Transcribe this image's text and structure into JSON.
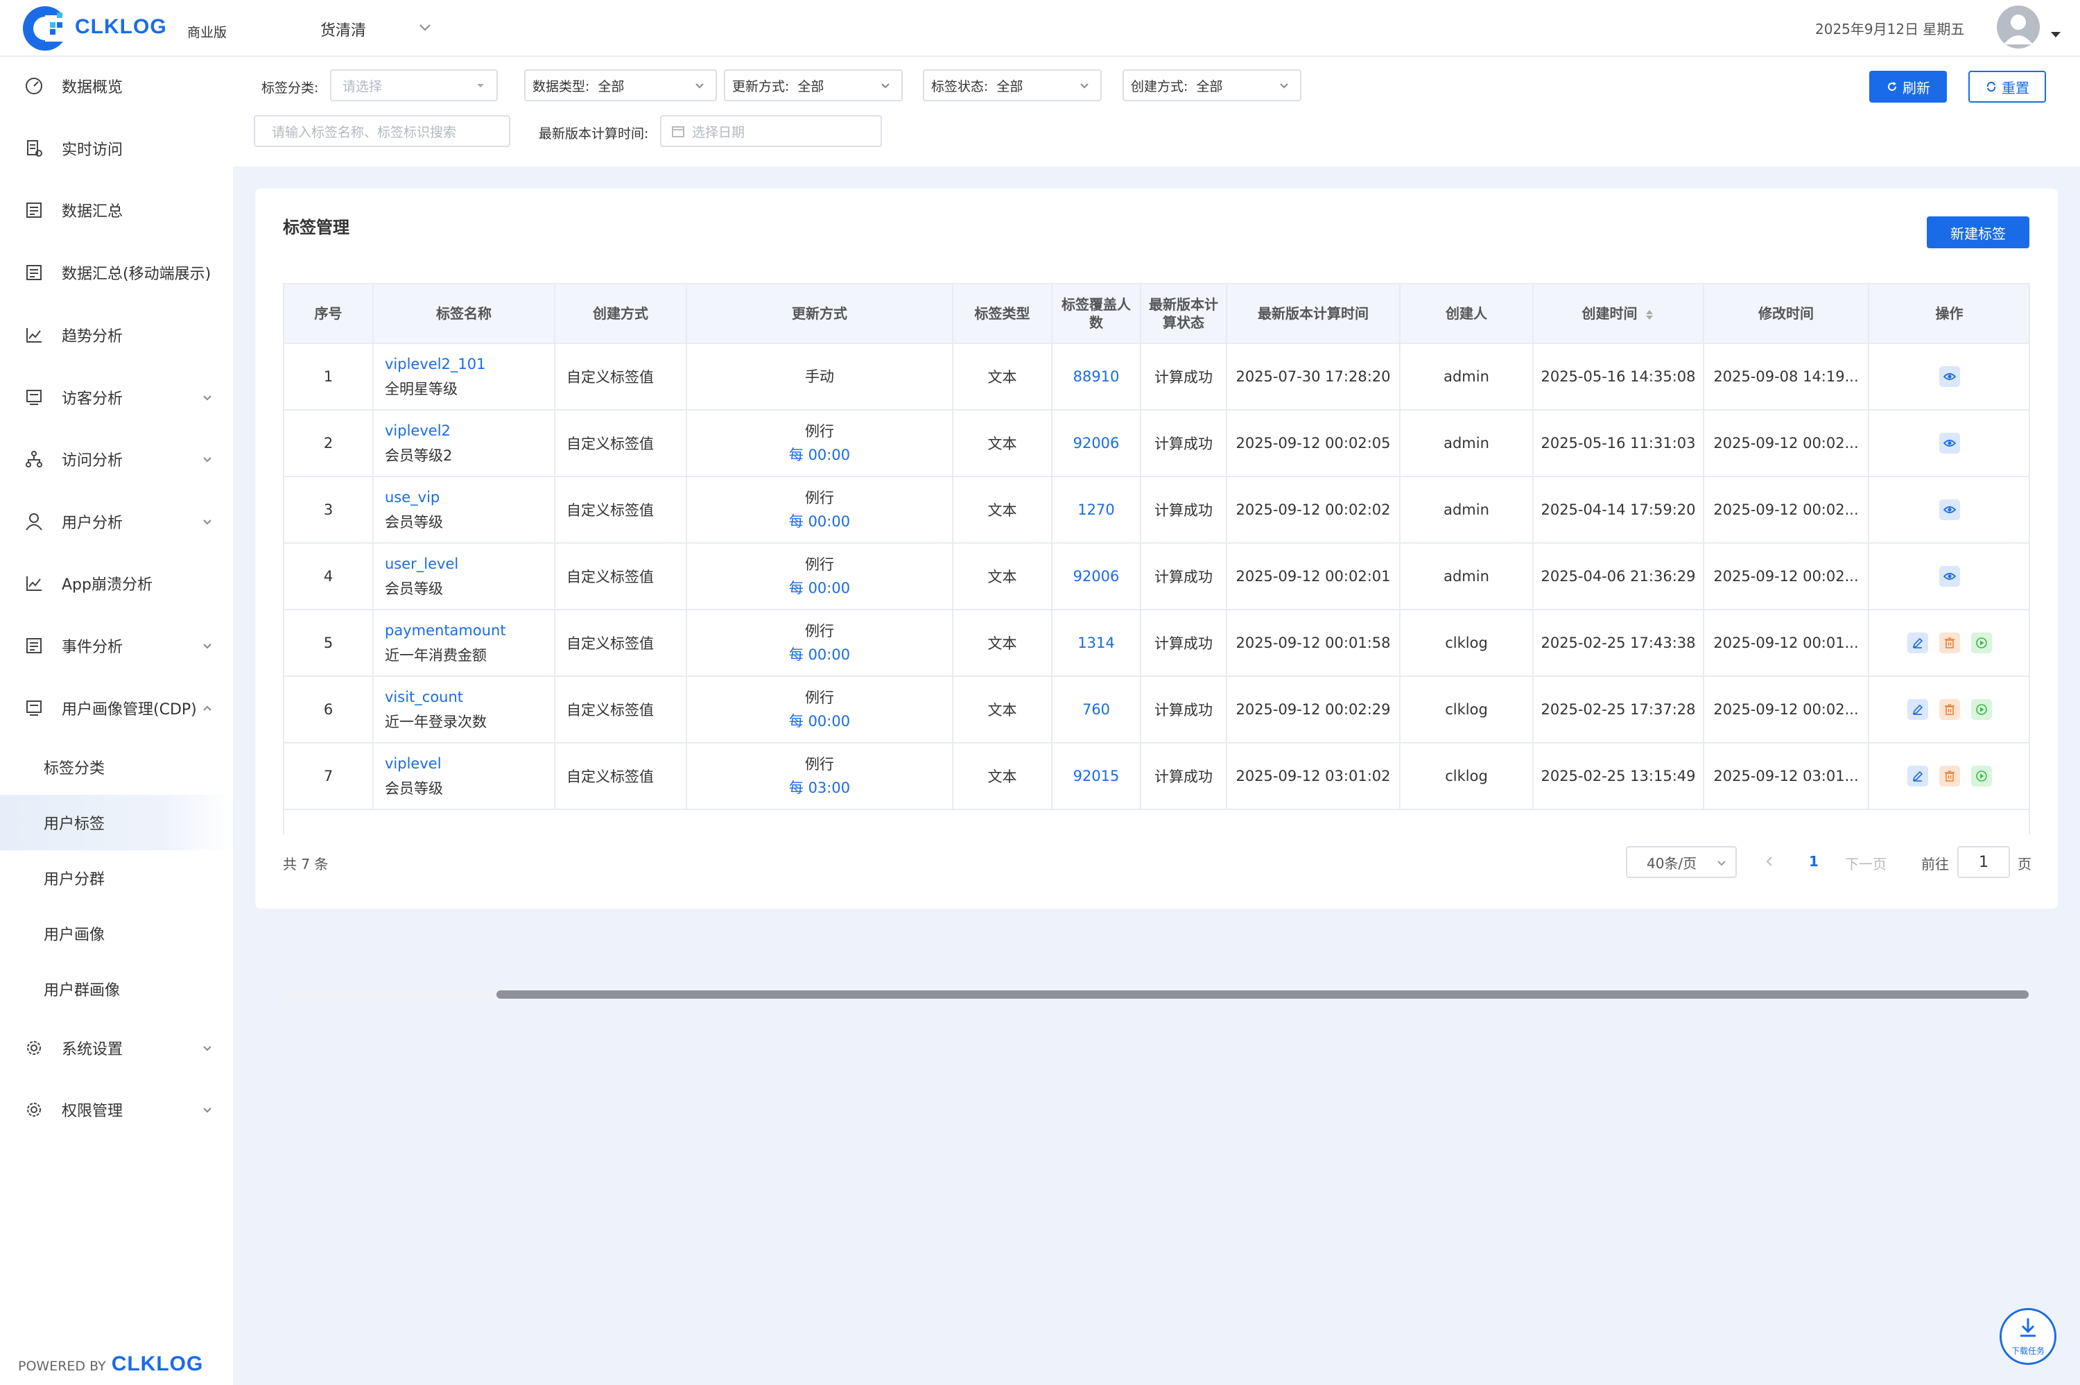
{
  "header": {
    "brand": "CLKLOG",
    "edition": "商业版",
    "org": "货清清",
    "date": "2025年9月12日 星期五"
  },
  "sidebar": {
    "items": [
      {
        "label": "数据概览",
        "icon": "dashboard-icon"
      },
      {
        "label": "实时访问",
        "icon": "realtime-icon"
      },
      {
        "label": "数据汇总",
        "icon": "summary-icon"
      },
      {
        "label": "数据汇总(移动端展示)",
        "icon": "summary-mobile-icon"
      },
      {
        "label": "趋势分析",
        "icon": "trend-icon"
      },
      {
        "label": "访客分析",
        "icon": "visitor-icon"
      },
      {
        "label": "访问分析",
        "icon": "visit-icon"
      },
      {
        "label": "用户分析",
        "icon": "user-icon"
      },
      {
        "label": "App崩溃分析",
        "icon": "crash-icon"
      },
      {
        "label": "事件分析",
        "icon": "event-icon"
      },
      {
        "label": "用户画像管理(CDP)",
        "icon": "cdp-icon"
      },
      {
        "label": "系统设置",
        "icon": "settings-icon"
      },
      {
        "label": "权限管理",
        "icon": "permission-icon"
      }
    ],
    "sub_items": [
      "标签分类",
      "用户标签",
      "用户分群",
      "用户画像",
      "用户群画像"
    ],
    "active_sub": "用户标签",
    "powered_by": "POWERED BY",
    "powered_brand": "CLKLOG"
  },
  "filters": {
    "category_label": "标签分类:",
    "category_placeholder": "请选择",
    "data_type_label": "数据类型:",
    "data_type_value": "全部",
    "update_label": "更新方式:",
    "update_value": "全部",
    "status_label": "标签状态:",
    "status_value": "全部",
    "create_label": "创建方式:",
    "create_value": "全部",
    "search_placeholder": "请输入标签名称、标签标识搜索",
    "calc_time_label": "最新版本计算时间:",
    "date_placeholder": "选择日期",
    "refresh": "刷新",
    "reset": "重置"
  },
  "card": {
    "title": "标签管理",
    "new_button": "新建标签"
  },
  "table": {
    "headers": [
      "序号",
      "标签名称",
      "创建方式",
      "更新方式",
      "标签类型",
      "标签覆盖人数",
      "最新版本计算状态",
      "最新版本计算时间",
      "创建人",
      "创建时间",
      "修改时间",
      "操作"
    ],
    "rows": [
      {
        "no": "1",
        "code": "viplevel2_101",
        "name": "全明星等级",
        "method": "自定义标签值",
        "update": "手动",
        "update_sched": "",
        "type": "文本",
        "count": "88910",
        "status": "计算成功",
        "calc_time": "2025-07-30 17:28:20",
        "creator": "admin",
        "created": "2025-05-16 14:35:08",
        "modified": "2025-09-08 14:19...",
        "ops": "view"
      },
      {
        "no": "2",
        "code": "viplevel2",
        "name": "会员等级2",
        "method": "自定义标签值",
        "update": "例行",
        "update_sched": "每 00:00",
        "type": "文本",
        "count": "92006",
        "status": "计算成功",
        "calc_time": "2025-09-12 00:02:05",
        "creator": "admin",
        "created": "2025-05-16 11:31:03",
        "modified": "2025-09-12 00:02...",
        "ops": "view"
      },
      {
        "no": "3",
        "code": "use_vip",
        "name": "会员等级",
        "method": "自定义标签值",
        "update": "例行",
        "update_sched": "每 00:00",
        "type": "文本",
        "count": "1270",
        "status": "计算成功",
        "calc_time": "2025-09-12 00:02:02",
        "creator": "admin",
        "created": "2025-04-14 17:59:20",
        "modified": "2025-09-12 00:02...",
        "ops": "view"
      },
      {
        "no": "4",
        "code": "user_level",
        "name": "会员等级",
        "method": "自定义标签值",
        "update": "例行",
        "update_sched": "每 00:00",
        "type": "文本",
        "count": "92006",
        "status": "计算成功",
        "calc_time": "2025-09-12 00:02:01",
        "creator": "admin",
        "created": "2025-04-06 21:36:29",
        "modified": "2025-09-12 00:02...",
        "ops": "view"
      },
      {
        "no": "5",
        "code": "paymentamount",
        "name": "近一年消费金额",
        "method": "自定义标签值",
        "update": "例行",
        "update_sched": "每 00:00",
        "type": "文本",
        "count": "1314",
        "status": "计算成功",
        "calc_time": "2025-09-12 00:01:58",
        "creator": "clklog",
        "created": "2025-02-25 17:43:38",
        "modified": "2025-09-12 00:01...",
        "ops": "edit"
      },
      {
        "no": "6",
        "code": "visit_count",
        "name": "近一年登录次数",
        "method": "自定义标签值",
        "update": "例行",
        "update_sched": "每 00:00",
        "type": "文本",
        "count": "760",
        "status": "计算成功",
        "calc_time": "2025-09-12 00:02:29",
        "creator": "clklog",
        "created": "2025-02-25 17:37:28",
        "modified": "2025-09-12 00:02...",
        "ops": "edit"
      },
      {
        "no": "7",
        "code": "viplevel",
        "name": "会员等级",
        "method": "自定义标签值",
        "update": "例行",
        "update_sched": "每 03:00",
        "type": "文本",
        "count": "92015",
        "status": "计算成功",
        "calc_time": "2025-09-12 03:01:02",
        "creator": "clklog",
        "created": "2025-02-25 13:15:49",
        "modified": "2025-09-12 03:01...",
        "ops": "edit"
      }
    ]
  },
  "pagination": {
    "total": "共 7 条",
    "page_size": "40条/页",
    "current": "1",
    "next": "下一页",
    "goto_label": "前往",
    "goto_value": "1",
    "goto_suffix": "页"
  },
  "download_task": "下载任务",
  "colors": {
    "accent": "#1a6be8",
    "page_bg": "#eef3fb"
  }
}
